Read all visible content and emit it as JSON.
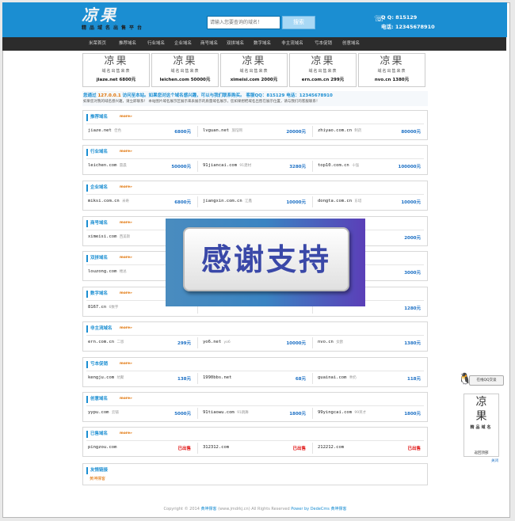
{
  "header": {
    "logo_main": "凉果",
    "logo_sub": "精品域名出售平台",
    "search_placeholder": "请输入您要查询的域名！",
    "search_button": "搜索",
    "qq_label": "Q Q: 815129",
    "phone_label": "电话: 12345678910"
  },
  "nav": {
    "items": [
      "米荣首页",
      "推荐域名",
      "行业域名",
      "企业域名",
      "商号域名",
      "双拼域名",
      "数字域名",
      "非主流域名",
      "亏本促销",
      "创意域名"
    ]
  },
  "banners": [
    {
      "logo": "凉果",
      "sub": "域名出售来表",
      "domain": "jiaze.net",
      "price": "6800元"
    },
    {
      "logo": "凉果",
      "sub": "域名出售来表",
      "domain": "leichen.com",
      "price": "50000元"
    },
    {
      "logo": "凉果",
      "sub": "域名出售来表",
      "domain": "ximeisi.com",
      "price": "2000元"
    },
    {
      "logo": "凉果",
      "sub": "域名出售来表",
      "domain": "ern.com.cn",
      "price": "299元"
    },
    {
      "logo": "凉果",
      "sub": "域名出售来表",
      "domain": "nvo.cn",
      "price": "1380元"
    }
  ],
  "notice": {
    "line1_prefix": "您通过",
    "ip": "127.0.0.1",
    "line1_suffix": "访问至本站。如果您对这个域名感兴趣，可以与我们联系购买。 客服QQ：815129 电话：12345678910",
    "line2": "如果您对我的域名感兴趣，请立即联系！ 本站图片域名展示区展示来表展示的质量域名展示，您如果想把域名出售在展示位置，请与我们的客服联系！"
  },
  "sections": [
    {
      "title": "推荐域名",
      "more": "more»",
      "rows": [
        {
          "domain": "jiaze.net",
          "tag": "佳色",
          "price": "6800元"
        },
        {
          "domain": "lvguan.net",
          "tag": "旅馆网",
          "price": "20000元"
        },
        {
          "domain": "zhiyao.com.cn",
          "tag": "制药",
          "price": "80000元"
        }
      ]
    },
    {
      "title": "行业域名",
      "more": "more»",
      "rows": [
        {
          "domain": "leichen.com",
          "tag": "雷晨",
          "price": "50000元"
        },
        {
          "domain": "91jiancai.com",
          "tag": "91建材",
          "price": "3280元"
        },
        {
          "domain": "top10.com.cn",
          "tag": "十强",
          "price": "100000元"
        }
      ]
    },
    {
      "title": "企业域名",
      "more": "more»",
      "rows": [
        {
          "domain": "miksi.com.cn",
          "tag": "米奇",
          "price": "6800元"
        },
        {
          "domain": "jiangxin.com.cn",
          "tag": "江鑫",
          "price": "10000元"
        },
        {
          "domain": "dongta.com.cn",
          "tag": "东塔",
          "price": "10000元"
        }
      ]
    },
    {
      "title": "商号域名",
      "more": "more»",
      "rows": [
        {
          "domain": "ximeisi.com",
          "tag": "西美斯",
          "price": ""
        },
        {
          "domain": "",
          "tag": "",
          "price": ""
        },
        {
          "domain": "",
          "tag": "",
          "price": "2000元"
        }
      ]
    },
    {
      "title": "双拼域名",
      "more": "more»",
      "rows": [
        {
          "domain": "louzong.com",
          "tag": "楼总",
          "price": ""
        },
        {
          "domain": "",
          "tag": "",
          "price": ""
        },
        {
          "domain": "",
          "tag": "",
          "price": "3000元"
        }
      ]
    },
    {
      "title": "数字域名",
      "more": "more»",
      "rows": [
        {
          "domain": "8167.cn",
          "tag": "6数字",
          "price": ""
        },
        {
          "domain": "",
          "tag": "",
          "price": ""
        },
        {
          "domain": "",
          "tag": "",
          "price": "1280元"
        }
      ]
    },
    {
      "title": "非主流域名",
      "more": "more»",
      "rows": [
        {
          "domain": "ern.com.cn",
          "tag": "二恩",
          "price": "299元"
        },
        {
          "domain": "yo6.net",
          "tag": "yo6",
          "price": "10000元"
        },
        {
          "domain": "nvo.cn",
          "tag": "女欧",
          "price": "1380元"
        }
      ]
    },
    {
      "title": "亏本促销",
      "more": "more»",
      "rows": [
        {
          "domain": "kengju.com",
          "tag": "坑聚",
          "price": "138元"
        },
        {
          "domain": "1990bbs.net",
          "tag": "",
          "price": "68元"
        },
        {
          "domain": "guainai.com",
          "tag": "乖奶",
          "price": "118元"
        }
      ]
    },
    {
      "title": "创意域名",
      "more": "more»",
      "rows": [
        {
          "domain": "yypu.com",
          "tag": "云铺",
          "price": "5000元"
        },
        {
          "domain": "91tiaowu.com",
          "tag": "91跳舞",
          "price": "1800元"
        },
        {
          "domain": "99yingcai.com",
          "tag": "99英才",
          "price": "1800元"
        }
      ]
    },
    {
      "title": "已售域名",
      "more": "more»",
      "rows": [
        {
          "domain": "pingzou.com",
          "tag": "",
          "price": "已出售"
        },
        {
          "domain": "312312.com",
          "tag": "",
          "price": "已出售"
        },
        {
          "domain": "212212.com",
          "tag": "",
          "price": "已出售"
        }
      ]
    }
  ],
  "links": {
    "title": "友情链接",
    "item": "黄坤撑客"
  },
  "footer": {
    "prefix": "Copyright © 2014",
    "site": "黄坤撑客",
    "middle": "(www.jmdrkj.cn) All Rights Reserved",
    "powered": "Power by DedeCms 黄坤撑客"
  },
  "overlay": {
    "text": "感谢支持"
  },
  "qq_float": {
    "label": "在线QQ交谈"
  },
  "side_ad": {
    "logo_top": "凉",
    "logo_bottom": "果",
    "sub": "精品域名",
    "top_link": "返回顶部",
    "close": "关闭"
  },
  "colors": {
    "header": "#1b8ed2",
    "nav": "#2c2c2c",
    "price": "#1b6fc4",
    "sold": "#e01010",
    "more": "#e07000"
  }
}
